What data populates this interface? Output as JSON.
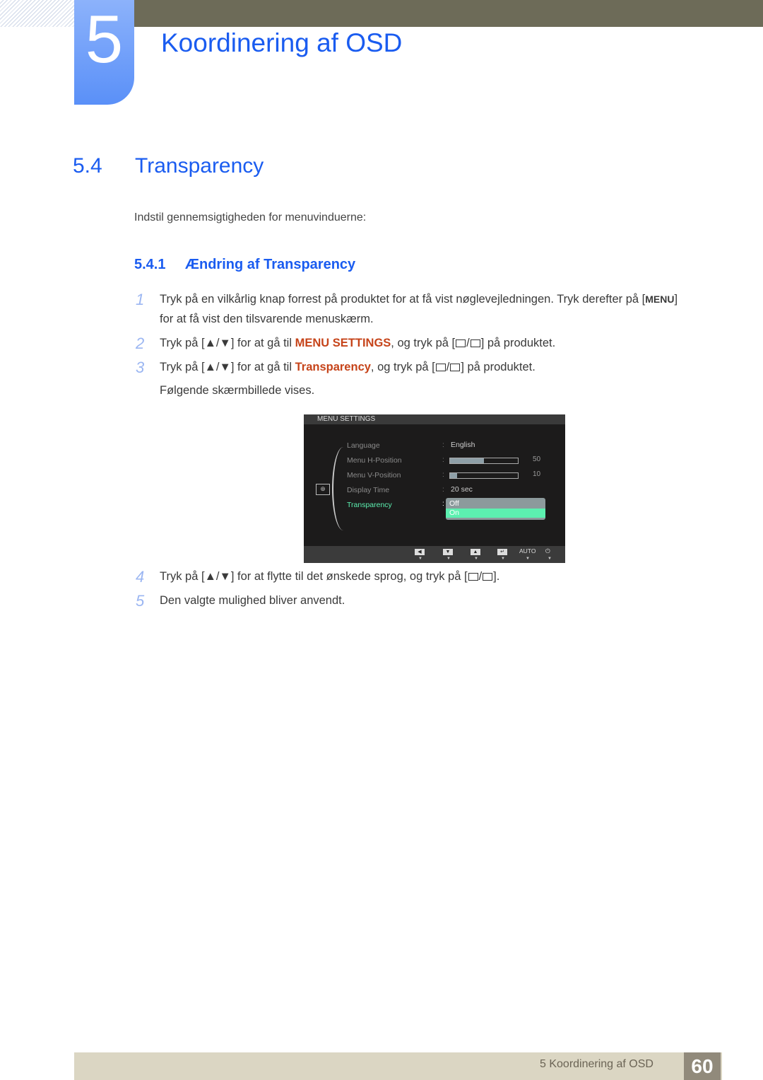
{
  "chapter": {
    "number": "5",
    "title": "Koordinering af OSD"
  },
  "section": {
    "number": "5.4",
    "title": "Transparency",
    "intro": "Indstil gennemsigtigheden for menuvinduerne:"
  },
  "subsection": {
    "number": "5.4.1",
    "title": "Ændring af Transparency"
  },
  "steps": [
    {
      "n": "1",
      "line1_a": "Tryk på en vilkårlig knap forrest på produktet for at få vist nøglevejledningen. Tryk derefter på [",
      "key": "MENU",
      "line1_b": "]",
      "line2": "for at få vist den tilsvarende menuskærm."
    },
    {
      "n": "2",
      "a": "Tryk på [▲/▼] for at gå til ",
      "hl": "MENU SETTINGS",
      "b": ", og tryk på [",
      "c": "] på produktet."
    },
    {
      "n": "3",
      "a": "Tryk på [▲/▼] for at gå til ",
      "hl": "Transparency",
      "b": ", og tryk på [",
      "c": "] på produktet.",
      "after": "Følgende skærmbillede vises."
    },
    {
      "n": "4",
      "a": "Tryk på [▲/▼] for at flytte til det ønskede sprog, og tryk på [",
      "c": "]."
    },
    {
      "n": "5",
      "a": "Den valgte mulighed bliver anvendt."
    }
  ],
  "osd": {
    "header": "MENU SETTINGS",
    "rows": [
      {
        "label": "Language",
        "value": "English"
      },
      {
        "label": "Menu H-Position",
        "value": "50",
        "progress": 0.5
      },
      {
        "label": "Menu V-Position",
        "value": "10",
        "progress": 0.1
      },
      {
        "label": "Display Time",
        "value": "20 sec"
      },
      {
        "label": "Transparency",
        "value": ""
      }
    ],
    "dropdown": {
      "options": [
        "Off",
        "On"
      ],
      "selected": "On"
    },
    "footer_buttons": [
      "◀",
      "▼",
      "▲",
      "↵",
      "AUTO",
      "⏻"
    ]
  },
  "footer": {
    "text": "5 Koordinering af OSD",
    "page": "60"
  }
}
